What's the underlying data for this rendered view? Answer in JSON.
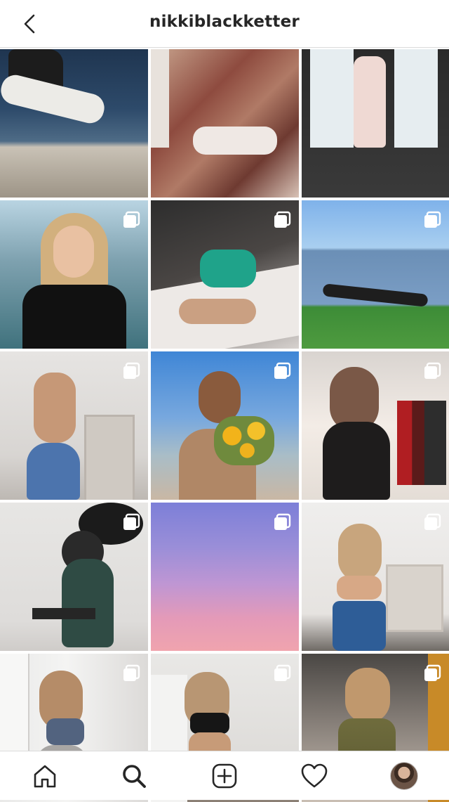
{
  "header": {
    "username": "nikkiblackketter"
  },
  "grid": {
    "tiles": [
      {
        "subject": "woman sitting by water",
        "multi": false
      },
      {
        "subject": "tie-dye sweater close-up",
        "multi": false
      },
      {
        "subject": "woman in doorway with drink",
        "multi": false
      },
      {
        "subject": "smiling woman in black top",
        "multi": true
      },
      {
        "subject": "woman in teal bikini lying down",
        "multi": true
      },
      {
        "subject": "woman doing plank on grass",
        "multi": true
      },
      {
        "subject": "mirror selfie in white top and jeans",
        "multi": true
      },
      {
        "subject": "woman holding sunflowers",
        "multi": true
      },
      {
        "subject": "woman with red wine",
        "multi": true
      },
      {
        "subject": "squat with barbell",
        "multi": true
      },
      {
        "subject": "pink and purple sky",
        "multi": true
      },
      {
        "subject": "mirror selfie in crop top",
        "multi": true
      },
      {
        "subject": "mirror selfie in sports bra",
        "multi": true
      },
      {
        "subject": "mirror selfie in black bikini",
        "multi": true
      },
      {
        "subject": "mirror selfie in olive slip dress",
        "multi": true
      }
    ]
  },
  "bottom_nav": {
    "items": [
      "home-icon",
      "search-icon",
      "new-post-icon",
      "activity-heart-icon",
      "profile-avatar"
    ]
  },
  "colors": {
    "text": "#262626",
    "divider": "#dbdbdb"
  }
}
